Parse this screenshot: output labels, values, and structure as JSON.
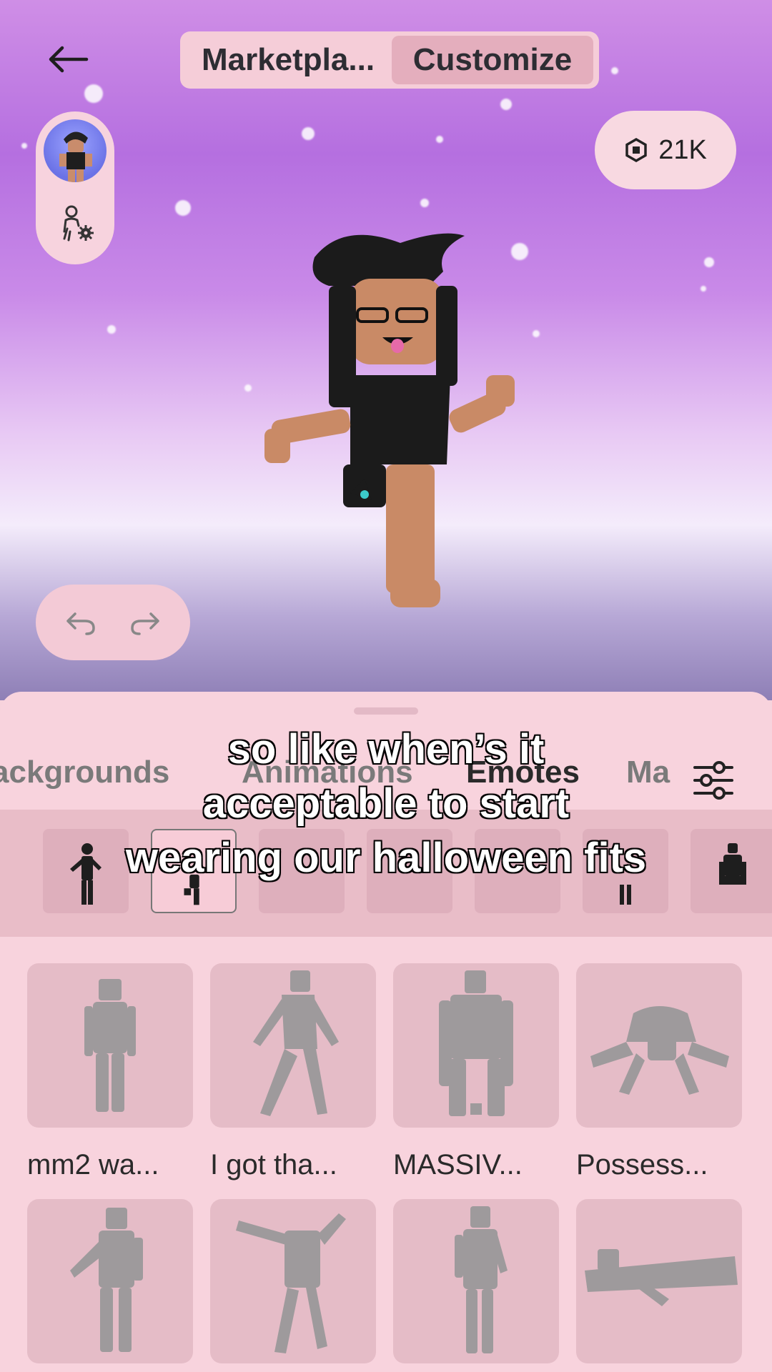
{
  "header": {
    "tabs": [
      {
        "label": "Marketpla..."
      },
      {
        "label": "Customize"
      }
    ]
  },
  "robux": {
    "amount": "21K",
    "icon": "robux-icon"
  },
  "categories": {
    "items": [
      {
        "label": "ackgrounds"
      },
      {
        "label": "Animations"
      },
      {
        "label": "Emotes"
      },
      {
        "label": "Ma"
      }
    ]
  },
  "subtitle": {
    "line1": "so like when’s it",
    "line2": "acceptable to start",
    "line3": "wearing our halloween fits"
  },
  "grid": {
    "items": [
      {
        "label": "mm2 wa..."
      },
      {
        "label": "I got tha..."
      },
      {
        "label": "MASSIV..."
      },
      {
        "label": "Possess..."
      }
    ]
  },
  "colors": {
    "accent_selected_tab": "#e4aebd",
    "sheet_background": "#f8d3dd",
    "card_background": "#e5bcc7",
    "silhouette": "#9e9a9c"
  }
}
